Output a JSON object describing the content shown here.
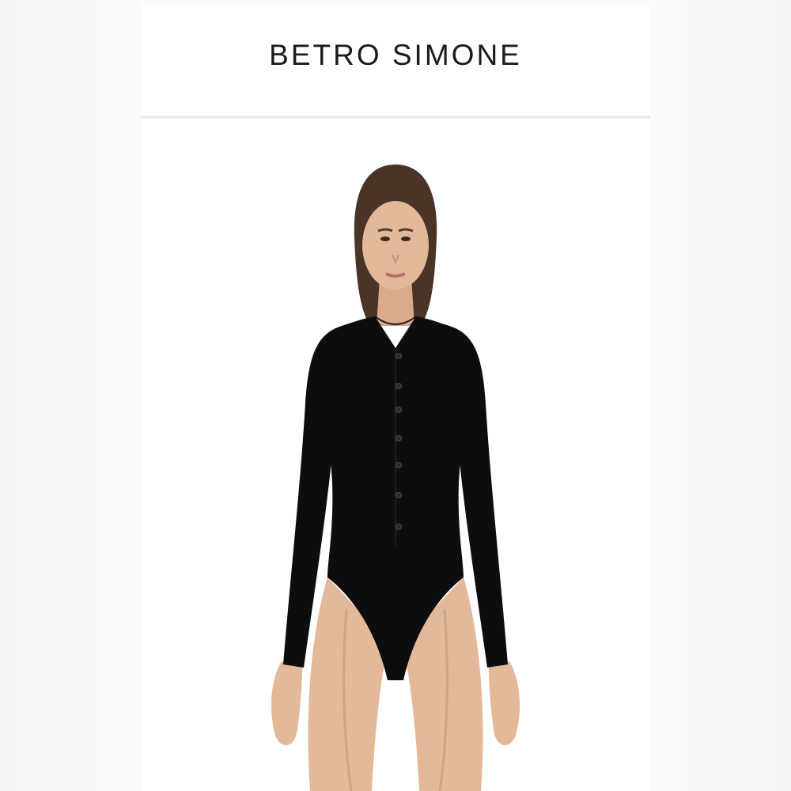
{
  "brand": {
    "name": "BETRO SIMONE"
  },
  "product_image": {
    "subject": "model-wearing-black-long-sleeve-button-bodysuit",
    "garment_color": "#0d0d0f",
    "skin_color": "#e3b99a",
    "hair_color": "#4a3327",
    "background_color": "#ffffff"
  },
  "colors": {
    "page_background": "#f7f6f5",
    "panel_background": "#ffffff",
    "divider": "#eeece8",
    "brand_text": "#1b1b1b"
  }
}
